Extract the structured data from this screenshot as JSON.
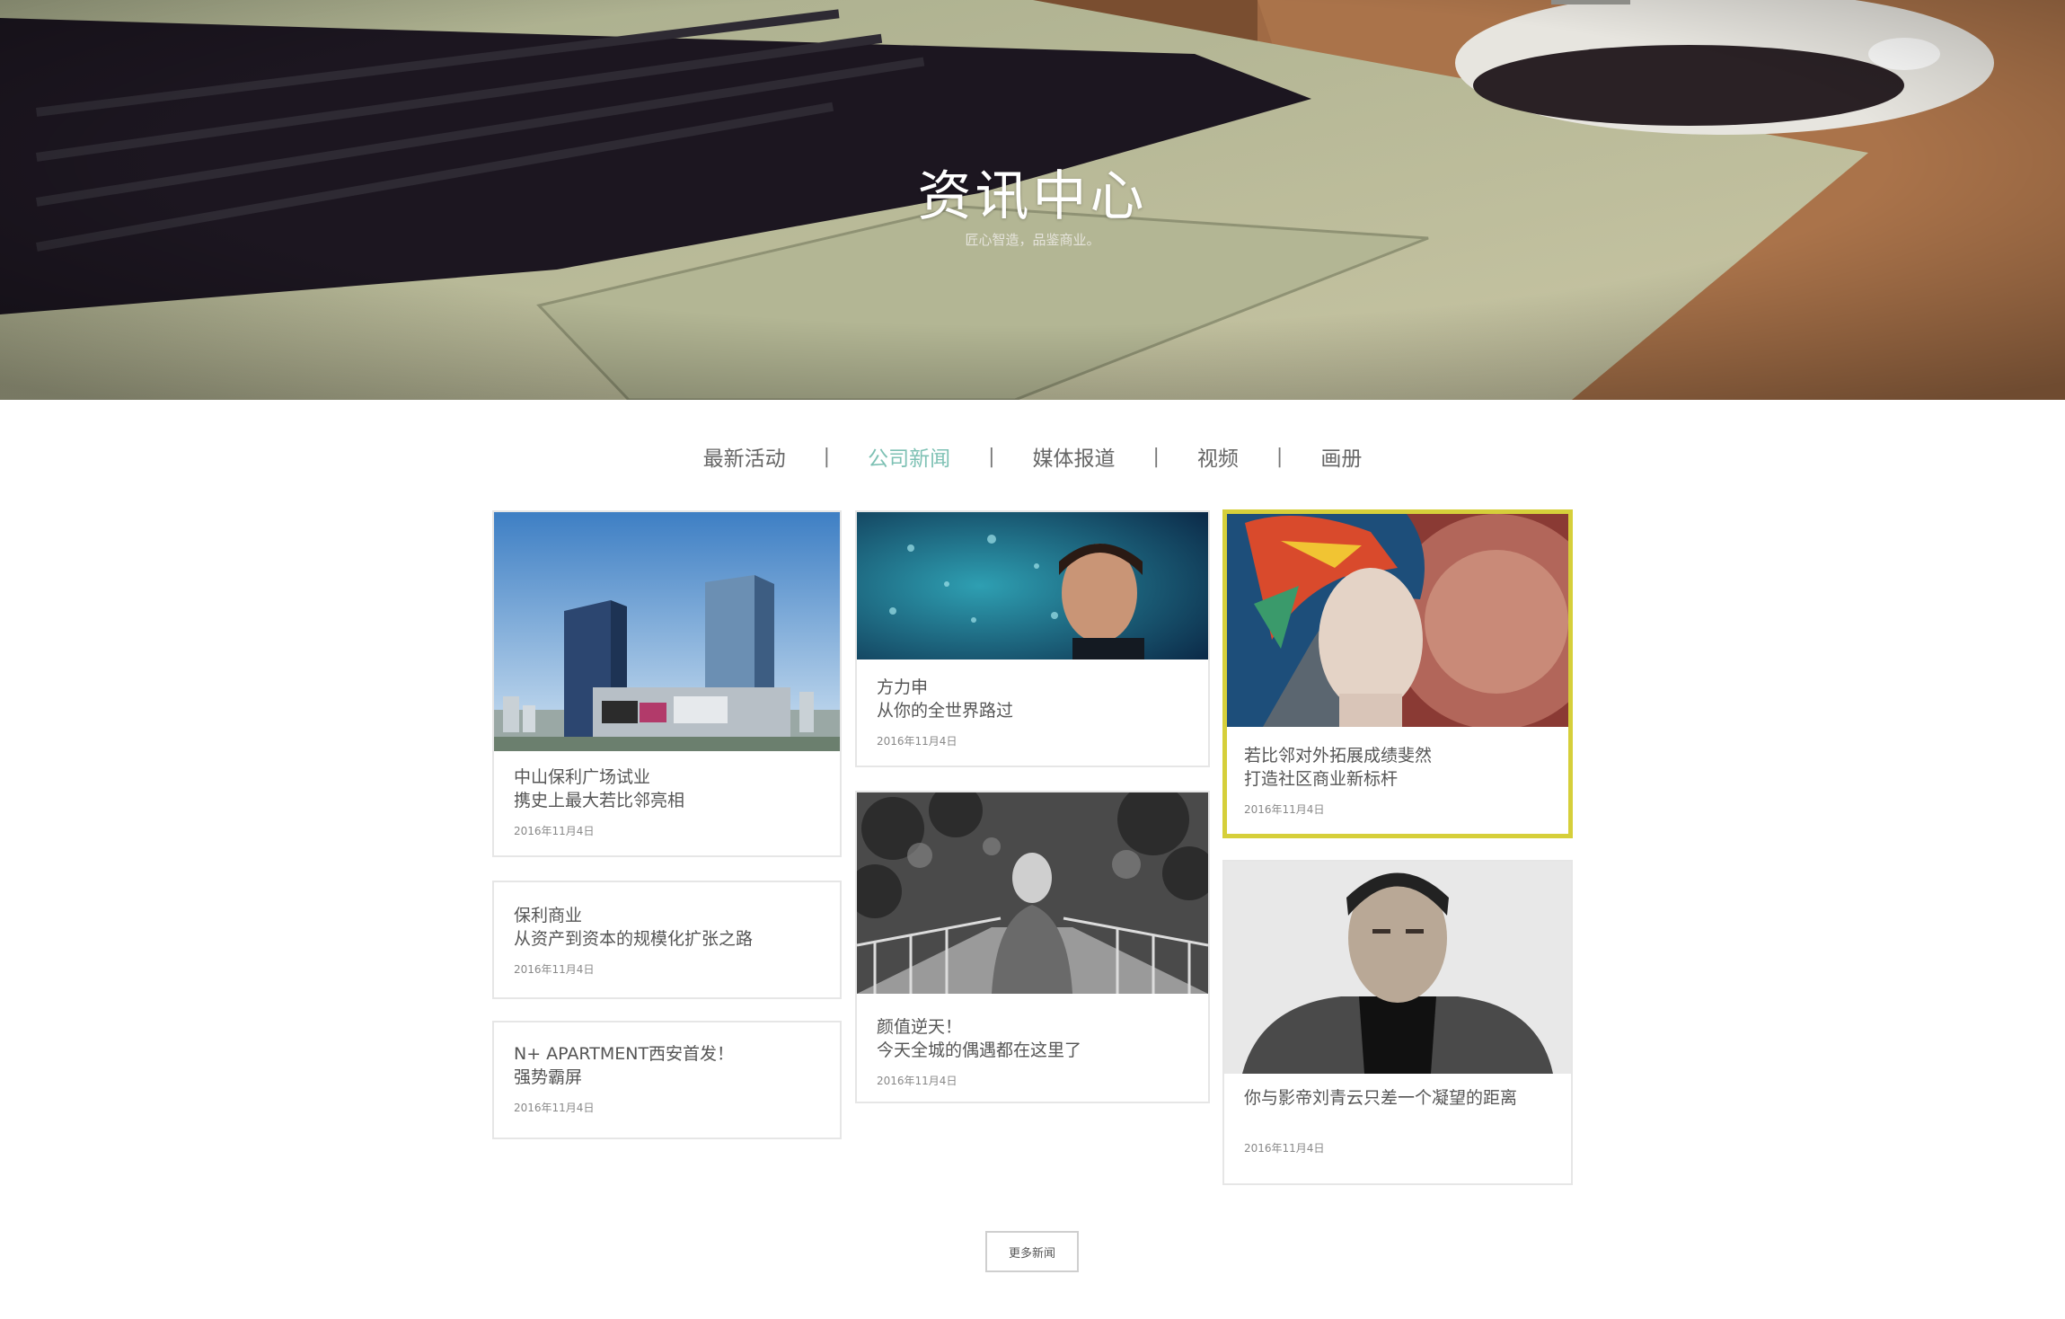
{
  "hero": {
    "title": "资讯中心",
    "subtitle": "匠心智造，品鉴商业。"
  },
  "tabs": [
    {
      "label": "最新活动",
      "active": false
    },
    {
      "label": "公司新闻",
      "active": true
    },
    {
      "label": "媒体报道",
      "active": false
    },
    {
      "label": "视频",
      "active": false
    },
    {
      "label": "画册",
      "active": false
    }
  ],
  "tab_separator": "|",
  "news": [
    {
      "line1": "中山保利广场试业",
      "line2": "携史上最大若比邻亮相",
      "date": "2016年11月4日"
    },
    {
      "line1": "保利商业",
      "line2": "从资产到资本的规模化扩张之路",
      "date": "2016年11月4日"
    },
    {
      "line1": "N+ APARTMENT西安首发！",
      "line2": "强势霸屏",
      "date": "2016年11月4日"
    },
    {
      "line1": "方力申",
      "line2": "从你的全世界路过",
      "date": "2016年11月4日"
    },
    {
      "line1": "颜值逆天！",
      "line2": "今天全城的偶遇都在这里了",
      "date": "2016年11月4日"
    },
    {
      "line1": "若比邻对外拓展成绩斐然",
      "line2": "打造社区商业新标杆",
      "date": "2016年11月4日"
    },
    {
      "line1": "你与影帝刘青云只差一个凝望的距离",
      "line2": "",
      "date": "2016年11月4日"
    }
  ],
  "more_button": "更多新闻",
  "colors": {
    "active_tab": "#7ec1b4",
    "highlight_border": "#d6cf3a",
    "card_border": "#e6e6e6"
  }
}
